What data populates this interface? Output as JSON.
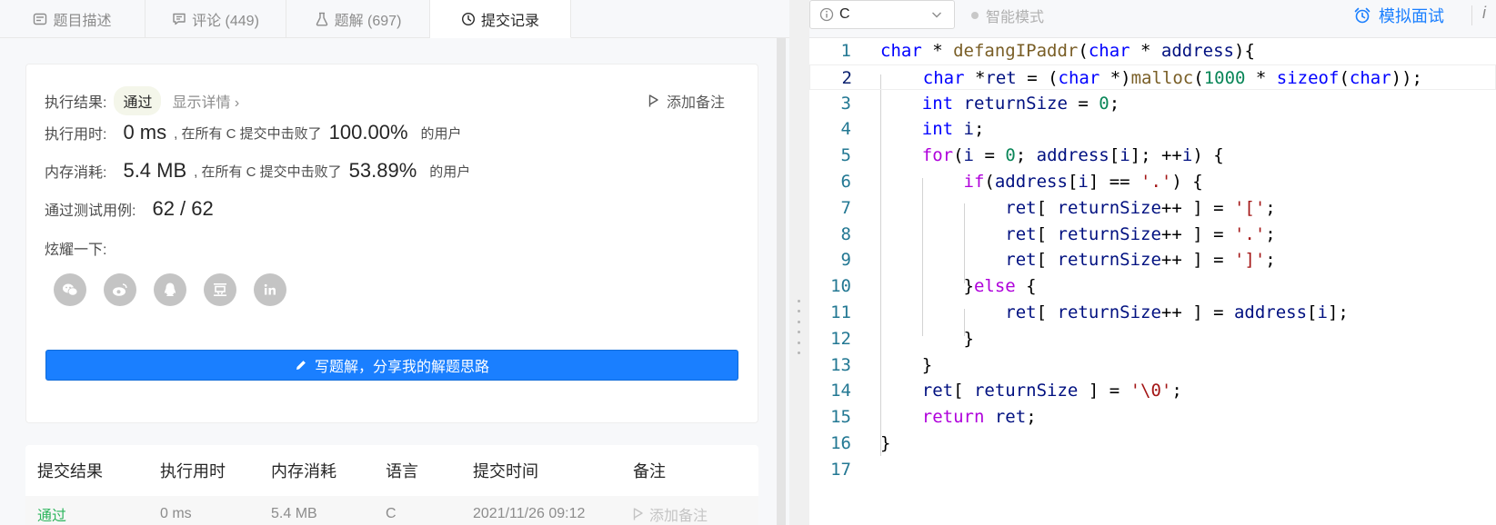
{
  "tabs": [
    {
      "label": "题目描述",
      "icon": "description-icon"
    },
    {
      "label": "评论 (449)",
      "icon": "comment-icon"
    },
    {
      "label": "题解 (697)",
      "icon": "flask-icon"
    },
    {
      "label": "提交记录",
      "icon": "clock-icon"
    }
  ],
  "result": {
    "result_label": "执行结果:",
    "result_value": "通过",
    "details_link": "显示详情 ›",
    "add_note": "添加备注",
    "time_label": "执行用时:",
    "time_value": "0 ms",
    "time_mid": ", 在所有 C 提交中击败了",
    "time_pct": "100.00%",
    "time_tail": "的用户",
    "mem_label": "内存消耗:",
    "mem_value": "5.4 MB",
    "mem_mid": ", 在所有 C 提交中击败了",
    "mem_pct": "53.89%",
    "mem_tail": "的用户",
    "tests_label": "通过测试用例:",
    "tests_value": "62 / 62",
    "share_label": "炫耀一下:",
    "share_icons": [
      "wechat-icon",
      "weibo-icon",
      "qq-icon",
      "douban-icon",
      "linkedin-icon"
    ],
    "write_button": "写题解，分享我的解题思路"
  },
  "submissions": {
    "headers": [
      "提交结果",
      "执行用时",
      "内存消耗",
      "语言",
      "提交时间",
      "备注"
    ],
    "rows": [
      {
        "status": "通过",
        "time": "0 ms",
        "memory": "5.4 MB",
        "lang": "C",
        "submitted": "2021/11/26 09:12",
        "note": "添加备注"
      }
    ]
  },
  "toolbar": {
    "language": "C",
    "smart_mode": "智能模式",
    "mock_interview": "模拟面试",
    "right_edge": "i"
  },
  "code_lines": [
    "char * defangIPaddr(char * address){",
    "    char *ret = (char *)malloc(1000 * sizeof(char));",
    "    int returnSize = 0;",
    "    int i;",
    "    for(i = 0; address[i]; ++i) {",
    "        if(address[i] == '.') {",
    "            ret[ returnSize++ ] = '[';",
    "            ret[ returnSize++ ] = '.';",
    "            ret[ returnSize++ ] = ']';",
    "        }else {",
    "            ret[ returnSize++ ] = address[i];",
    "        }",
    "    }",
    "    ret[ returnSize ] = '\\0';",
    "    return ret;",
    "}",
    ""
  ],
  "colors": {
    "accent": "#1a7fff",
    "pass_green": "#2db55d",
    "keyword": "#0000ff",
    "control": "#af00db",
    "function": "#795e26",
    "variable": "#001080",
    "number": "#098658",
    "string": "#a31515",
    "line_number": "#237893"
  }
}
